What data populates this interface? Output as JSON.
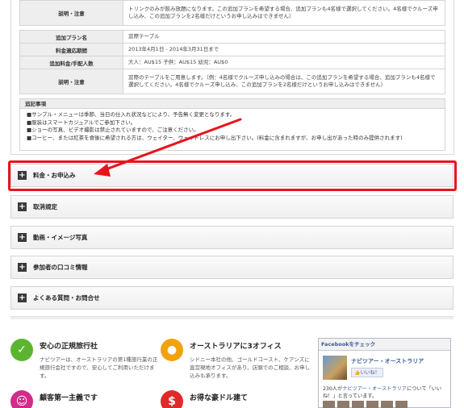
{
  "plan_top": {
    "notes_label": "説明・注意",
    "notes_text": "トリンクのみが飲み放題になります。この追加プランを希望する場合、追加プランも4名様で選択してください。4名様でクルーズ申し込み、この追加プランを2名様だけというお申し込みはできません）"
  },
  "plan_window": {
    "rows": [
      {
        "label": "追加プラン名",
        "value": "窓際テーブル"
      },
      {
        "label": "料金適応期間",
        "value": "2013年4月1日 - 2014年3月31日まで"
      },
      {
        "label": "追加料金/手配人数",
        "value": "大人：AU$15 子供：AU$15 幼児：AU$0"
      },
      {
        "label": "説明・注意",
        "value": "窓際のテーブルをご用意します。（例：4名様でクルーズ申し込みの場合は、この追加プランを希望する場合、追加プランも4名様で選択してください。4名様でクルーズ申し込み、この追加プランを2名様だけというお申し込みはできません）"
      }
    ]
  },
  "notes": {
    "header": "追記事項",
    "lines": [
      "■サンプル・メニューは季節、当日の仕入れ状況などにより、予告無く変更となります。",
      "■服装はスマートカジュアルでご参加下さい。",
      "■ショーの写真、ビデオ撮影は禁止されていますので、ご注意ください。",
      "■コーヒー、または紅茶を食後に希望される方は、ウェイター、ウェイトレスにお申し出下さい。(料金に含まれますが、お申し出があった時のみ提供されます)"
    ]
  },
  "accordion": [
    {
      "label": "料金・お申込み"
    },
    {
      "label": "取消規定"
    },
    {
      "label": "動画・イメージ写真"
    },
    {
      "label": "参加者の口コミ情報"
    },
    {
      "label": "よくある質問・お問合せ"
    }
  ],
  "features": [
    {
      "title": "安心の正規旅行社",
      "desc": "ナビツアーは、オーストラリアの第1種旅行業の正規旅行会社ですので、安心してご利用いただけます。",
      "icon": "check-icon",
      "color": "#5cb531"
    },
    {
      "title": "オーストラリアに3オフィス",
      "desc": "シドニー本社の他、ゴールドコースト、ケアンズに直営現地オフィスがあり、店頭でのご相談、お申し込みも承ります。",
      "icon": "pin-icon",
      "color": "#f2a20c"
    },
    {
      "title": "顧客第一主義です",
      "desc": "",
      "icon": "people-icon",
      "color": "#d42a8a"
    },
    {
      "title": "お得な豪ドル建て",
      "desc": "",
      "icon": "money-icon",
      "color": "#e02a2a"
    }
  ],
  "facebook": {
    "header": "Facebookをチェック",
    "page_name": "ナビツアー・オーストラリア",
    "like_label": "いいね！",
    "count_prefix": "230人が",
    "count_link": "ナビツアー・オーストラリア",
    "count_suffix": "について「いいね！」と言っています。"
  },
  "colors": {
    "highlight": "#e8141c",
    "arrow": "#e8141c"
  }
}
